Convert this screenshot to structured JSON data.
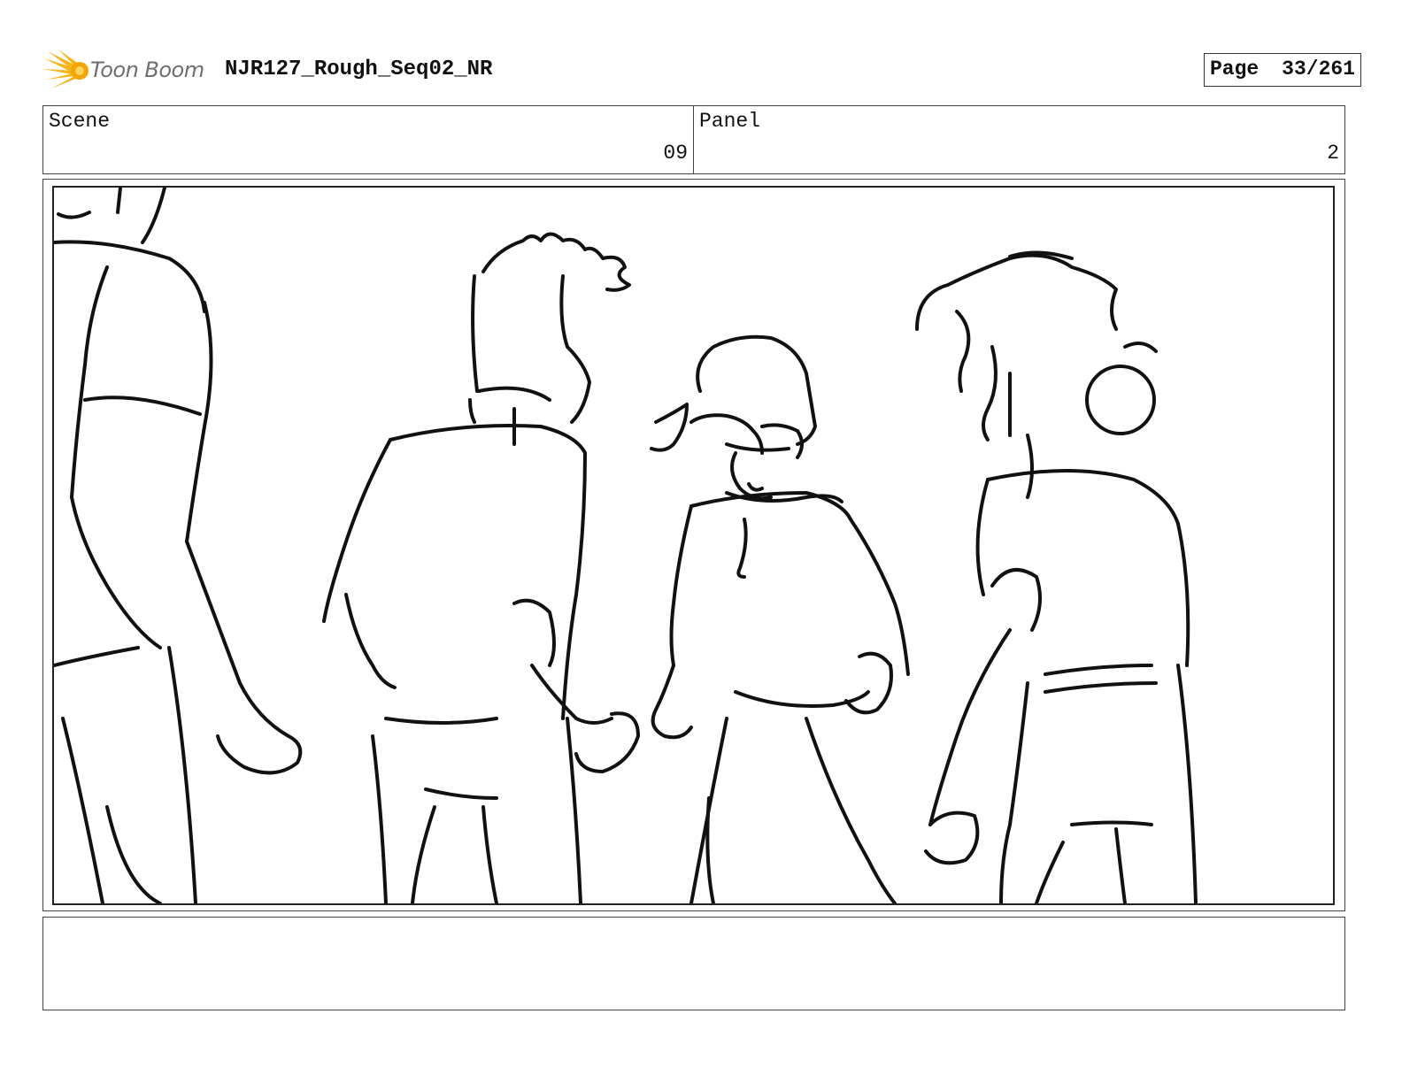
{
  "header": {
    "logo_text": "Toon Boom",
    "project_title": "NJR127_Rough_Seq02_NR",
    "page_label": "Page",
    "page_number": "33/261"
  },
  "info": {
    "scene_label": "Scene",
    "scene_value": "09",
    "panel_label": "Panel",
    "panel_value": "2"
  },
  "panel_image": {
    "icon": "storyboard-sketch"
  },
  "notes": {
    "text": ""
  }
}
